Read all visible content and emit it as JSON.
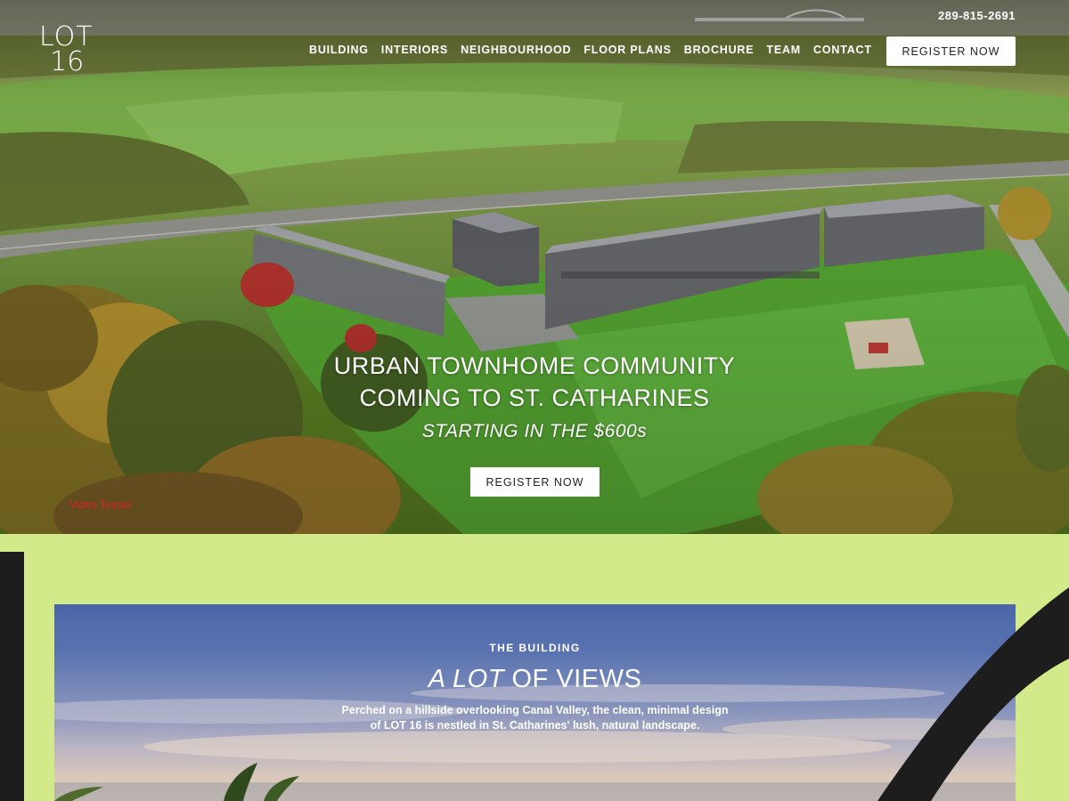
{
  "brand": {
    "logo_line1": "LOT",
    "logo_line2": "16"
  },
  "header": {
    "phone": "289-815-2691",
    "nav": [
      "BUILDING",
      "INTERIORS",
      "NEIGHBOURHOOD",
      "FLOOR PLANS",
      "BROCHURE",
      "TEAM",
      "CONTACT"
    ],
    "register_label": "REGISTER NOW"
  },
  "hero": {
    "headline_line1": "URBAN TOWNHOME COMMUNITY",
    "headline_line2": "COMING TO ST. CATHARINES",
    "subheadline": "STARTING IN THE $600s",
    "register_label": "REGISTER NOW",
    "video_teaser": "Video Teaser"
  },
  "building": {
    "kicker": "THE BUILDING",
    "title_italic": "A LOT",
    "title_rest": " OF VIEWS",
    "desc_line1": "Perched on a hillside overlooking Canal Valley, the clean, minimal design",
    "desc_line2": "of LOT 16 is nestled in St. Catharines' lush, natural landscape."
  },
  "colors": {
    "accent_green": "#d3ea8a",
    "dark": "#1d1d1d",
    "button_bg": "#ffffff",
    "teaser_red": "#dd2222"
  }
}
